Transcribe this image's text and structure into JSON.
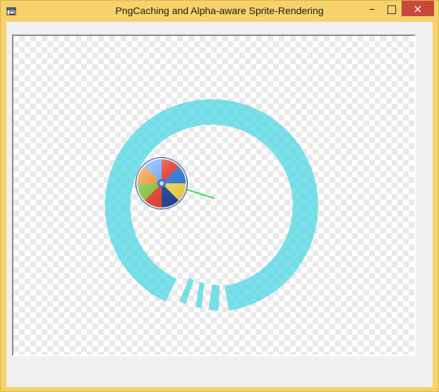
{
  "window": {
    "title": "PngCaching and Alpha-aware Sprite-Rendering",
    "app_icon": "app-window-icon",
    "buttons": {
      "minimize": "–",
      "maximize": "□",
      "close": "×"
    }
  },
  "canvas": {
    "background": "checkerboard",
    "ring_color": "#55d8e6",
    "ring_opacity": 0.78,
    "pointer_color": "#2ee34b",
    "sprite": "color-wheel-sprite"
  }
}
